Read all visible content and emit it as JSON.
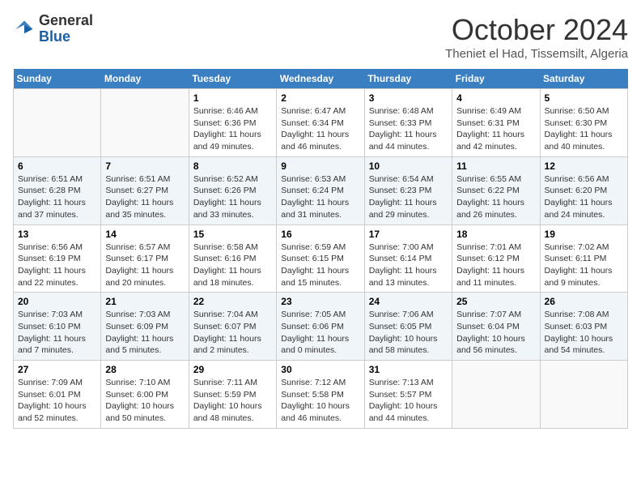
{
  "header": {
    "logo_general": "General",
    "logo_blue": "Blue",
    "month_title": "October 2024",
    "location": "Theniet el Had, Tissemsilt, Algeria"
  },
  "days_of_week": [
    "Sunday",
    "Monday",
    "Tuesday",
    "Wednesday",
    "Thursday",
    "Friday",
    "Saturday"
  ],
  "weeks": [
    [
      {
        "num": "",
        "sunrise": "",
        "sunset": "",
        "daylight": ""
      },
      {
        "num": "",
        "sunrise": "",
        "sunset": "",
        "daylight": ""
      },
      {
        "num": "1",
        "sunrise": "Sunrise: 6:46 AM",
        "sunset": "Sunset: 6:36 PM",
        "daylight": "Daylight: 11 hours and 49 minutes."
      },
      {
        "num": "2",
        "sunrise": "Sunrise: 6:47 AM",
        "sunset": "Sunset: 6:34 PM",
        "daylight": "Daylight: 11 hours and 46 minutes."
      },
      {
        "num": "3",
        "sunrise": "Sunrise: 6:48 AM",
        "sunset": "Sunset: 6:33 PM",
        "daylight": "Daylight: 11 hours and 44 minutes."
      },
      {
        "num": "4",
        "sunrise": "Sunrise: 6:49 AM",
        "sunset": "Sunset: 6:31 PM",
        "daylight": "Daylight: 11 hours and 42 minutes."
      },
      {
        "num": "5",
        "sunrise": "Sunrise: 6:50 AM",
        "sunset": "Sunset: 6:30 PM",
        "daylight": "Daylight: 11 hours and 40 minutes."
      }
    ],
    [
      {
        "num": "6",
        "sunrise": "Sunrise: 6:51 AM",
        "sunset": "Sunset: 6:28 PM",
        "daylight": "Daylight: 11 hours and 37 minutes."
      },
      {
        "num": "7",
        "sunrise": "Sunrise: 6:51 AM",
        "sunset": "Sunset: 6:27 PM",
        "daylight": "Daylight: 11 hours and 35 minutes."
      },
      {
        "num": "8",
        "sunrise": "Sunrise: 6:52 AM",
        "sunset": "Sunset: 6:26 PM",
        "daylight": "Daylight: 11 hours and 33 minutes."
      },
      {
        "num": "9",
        "sunrise": "Sunrise: 6:53 AM",
        "sunset": "Sunset: 6:24 PM",
        "daylight": "Daylight: 11 hours and 31 minutes."
      },
      {
        "num": "10",
        "sunrise": "Sunrise: 6:54 AM",
        "sunset": "Sunset: 6:23 PM",
        "daylight": "Daylight: 11 hours and 29 minutes."
      },
      {
        "num": "11",
        "sunrise": "Sunrise: 6:55 AM",
        "sunset": "Sunset: 6:22 PM",
        "daylight": "Daylight: 11 hours and 26 minutes."
      },
      {
        "num": "12",
        "sunrise": "Sunrise: 6:56 AM",
        "sunset": "Sunset: 6:20 PM",
        "daylight": "Daylight: 11 hours and 24 minutes."
      }
    ],
    [
      {
        "num": "13",
        "sunrise": "Sunrise: 6:56 AM",
        "sunset": "Sunset: 6:19 PM",
        "daylight": "Daylight: 11 hours and 22 minutes."
      },
      {
        "num": "14",
        "sunrise": "Sunrise: 6:57 AM",
        "sunset": "Sunset: 6:17 PM",
        "daylight": "Daylight: 11 hours and 20 minutes."
      },
      {
        "num": "15",
        "sunrise": "Sunrise: 6:58 AM",
        "sunset": "Sunset: 6:16 PM",
        "daylight": "Daylight: 11 hours and 18 minutes."
      },
      {
        "num": "16",
        "sunrise": "Sunrise: 6:59 AM",
        "sunset": "Sunset: 6:15 PM",
        "daylight": "Daylight: 11 hours and 15 minutes."
      },
      {
        "num": "17",
        "sunrise": "Sunrise: 7:00 AM",
        "sunset": "Sunset: 6:14 PM",
        "daylight": "Daylight: 11 hours and 13 minutes."
      },
      {
        "num": "18",
        "sunrise": "Sunrise: 7:01 AM",
        "sunset": "Sunset: 6:12 PM",
        "daylight": "Daylight: 11 hours and 11 minutes."
      },
      {
        "num": "19",
        "sunrise": "Sunrise: 7:02 AM",
        "sunset": "Sunset: 6:11 PM",
        "daylight": "Daylight: 11 hours and 9 minutes."
      }
    ],
    [
      {
        "num": "20",
        "sunrise": "Sunrise: 7:03 AM",
        "sunset": "Sunset: 6:10 PM",
        "daylight": "Daylight: 11 hours and 7 minutes."
      },
      {
        "num": "21",
        "sunrise": "Sunrise: 7:03 AM",
        "sunset": "Sunset: 6:09 PM",
        "daylight": "Daylight: 11 hours and 5 minutes."
      },
      {
        "num": "22",
        "sunrise": "Sunrise: 7:04 AM",
        "sunset": "Sunset: 6:07 PM",
        "daylight": "Daylight: 11 hours and 2 minutes."
      },
      {
        "num": "23",
        "sunrise": "Sunrise: 7:05 AM",
        "sunset": "Sunset: 6:06 PM",
        "daylight": "Daylight: 11 hours and 0 minutes."
      },
      {
        "num": "24",
        "sunrise": "Sunrise: 7:06 AM",
        "sunset": "Sunset: 6:05 PM",
        "daylight": "Daylight: 10 hours and 58 minutes."
      },
      {
        "num": "25",
        "sunrise": "Sunrise: 7:07 AM",
        "sunset": "Sunset: 6:04 PM",
        "daylight": "Daylight: 10 hours and 56 minutes."
      },
      {
        "num": "26",
        "sunrise": "Sunrise: 7:08 AM",
        "sunset": "Sunset: 6:03 PM",
        "daylight": "Daylight: 10 hours and 54 minutes."
      }
    ],
    [
      {
        "num": "27",
        "sunrise": "Sunrise: 7:09 AM",
        "sunset": "Sunset: 6:01 PM",
        "daylight": "Daylight: 10 hours and 52 minutes."
      },
      {
        "num": "28",
        "sunrise": "Sunrise: 7:10 AM",
        "sunset": "Sunset: 6:00 PM",
        "daylight": "Daylight: 10 hours and 50 minutes."
      },
      {
        "num": "29",
        "sunrise": "Sunrise: 7:11 AM",
        "sunset": "Sunset: 5:59 PM",
        "daylight": "Daylight: 10 hours and 48 minutes."
      },
      {
        "num": "30",
        "sunrise": "Sunrise: 7:12 AM",
        "sunset": "Sunset: 5:58 PM",
        "daylight": "Daylight: 10 hours and 46 minutes."
      },
      {
        "num": "31",
        "sunrise": "Sunrise: 7:13 AM",
        "sunset": "Sunset: 5:57 PM",
        "daylight": "Daylight: 10 hours and 44 minutes."
      },
      {
        "num": "",
        "sunrise": "",
        "sunset": "",
        "daylight": ""
      },
      {
        "num": "",
        "sunrise": "",
        "sunset": "",
        "daylight": ""
      }
    ]
  ]
}
